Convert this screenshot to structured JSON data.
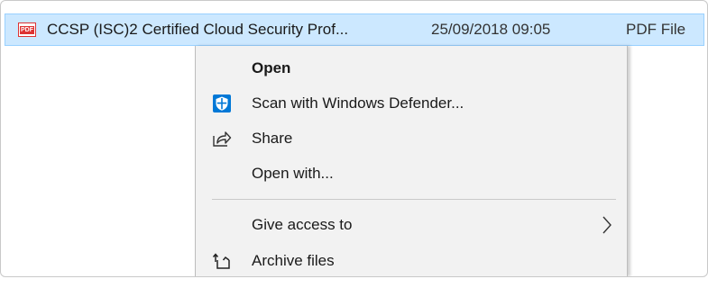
{
  "file": {
    "icon": "pdf-icon",
    "icon_text": "PDF",
    "name": "CCSP (ISC)2 Certified Cloud Security Prof...",
    "date_modified": "25/09/2018 09:05",
    "type": "PDF File"
  },
  "context_menu": {
    "items": [
      {
        "label": "Open",
        "icon": null,
        "bold": true
      },
      {
        "label": "Scan with Windows Defender...",
        "icon": "windows-defender-shield-icon"
      },
      {
        "label": "Share",
        "icon": "share-icon"
      },
      {
        "label": "Open with...",
        "icon": null
      },
      {
        "label": "Give access to",
        "icon": null,
        "submenu": true
      },
      {
        "label": "Archive files",
        "icon": "archive-icon"
      }
    ]
  },
  "colors": {
    "selection_bg": "#cce8ff",
    "selection_border": "#99d1ff",
    "menu_bg": "#f2f2f2",
    "defender_blue": "#0078d7",
    "pdf_red": "#dd3333"
  }
}
